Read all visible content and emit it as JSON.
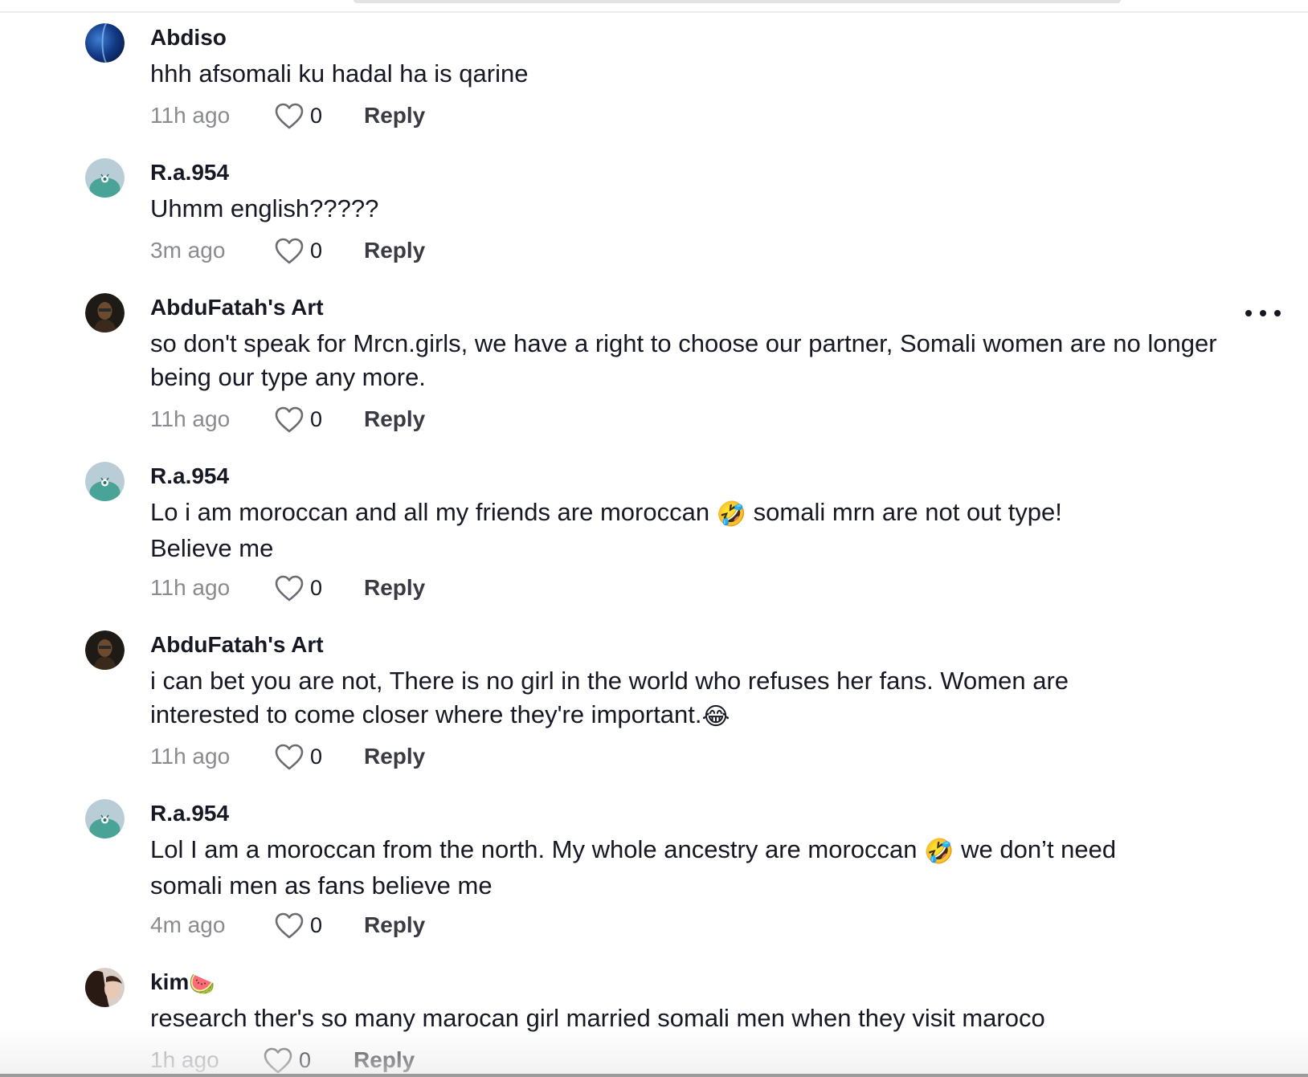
{
  "comments": [
    {
      "username": "Abdiso",
      "avatar": "blue-sphere",
      "text": "hhh afsomali ku hadal ha is qarine",
      "timestamp": "11h ago",
      "likes": "0",
      "reply_label": "Reply"
    },
    {
      "username": "R.a.954",
      "avatar": "teal-bird",
      "text": "Uhmm english?????",
      "timestamp": "3m ago",
      "likes": "0",
      "reply_label": "Reply"
    },
    {
      "username": "AbduFatah's Art",
      "avatar": "dark-photo",
      "text": "so don't speak for Mrcn.girls, we have a right to choose our partner, Somali women are no longer being our type any more.",
      "timestamp": "11h ago",
      "likes": "0",
      "reply_label": "Reply"
    },
    {
      "username": "R.a.954",
      "avatar": "teal-bird",
      "text_before": "Lo i am moroccan and all my friends are moroccan ",
      "emoji": "🤣",
      "text_after": " somali mrn are not out type!",
      "text_line2": "Believe me",
      "timestamp": "11h ago",
      "likes": "0",
      "reply_label": "Reply"
    },
    {
      "username": "AbduFatah's Art",
      "avatar": "dark-photo",
      "text_line1": "i can bet you are not, There is no girl in the world who refuses her fans. Women are",
      "text_line2": "interested to come closer where they're important.",
      "emoji": "😂",
      "timestamp": "11h ago",
      "likes": "0",
      "reply_label": "Reply"
    },
    {
      "username": "R.a.954",
      "avatar": "teal-bird",
      "text_before": "Lol I am a moroccan from the north. My whole ancestry are moroccan ",
      "emoji": "🤣",
      "text_after": " we don’t need",
      "text_line2": "somali men as fans believe me",
      "timestamp": "4m ago",
      "likes": "0",
      "reply_label": "Reply"
    },
    {
      "username": "kim",
      "username_emoji": "🍉",
      "avatar": "girl-photo",
      "text": "research ther's so many marocan girl married somali men when they visit maroco",
      "timestamp": "1h ago",
      "likes": "0",
      "reply_label": "Reply"
    }
  ],
  "icons": {
    "like": "heart-outline-icon",
    "more": "ellipsis-icon"
  }
}
